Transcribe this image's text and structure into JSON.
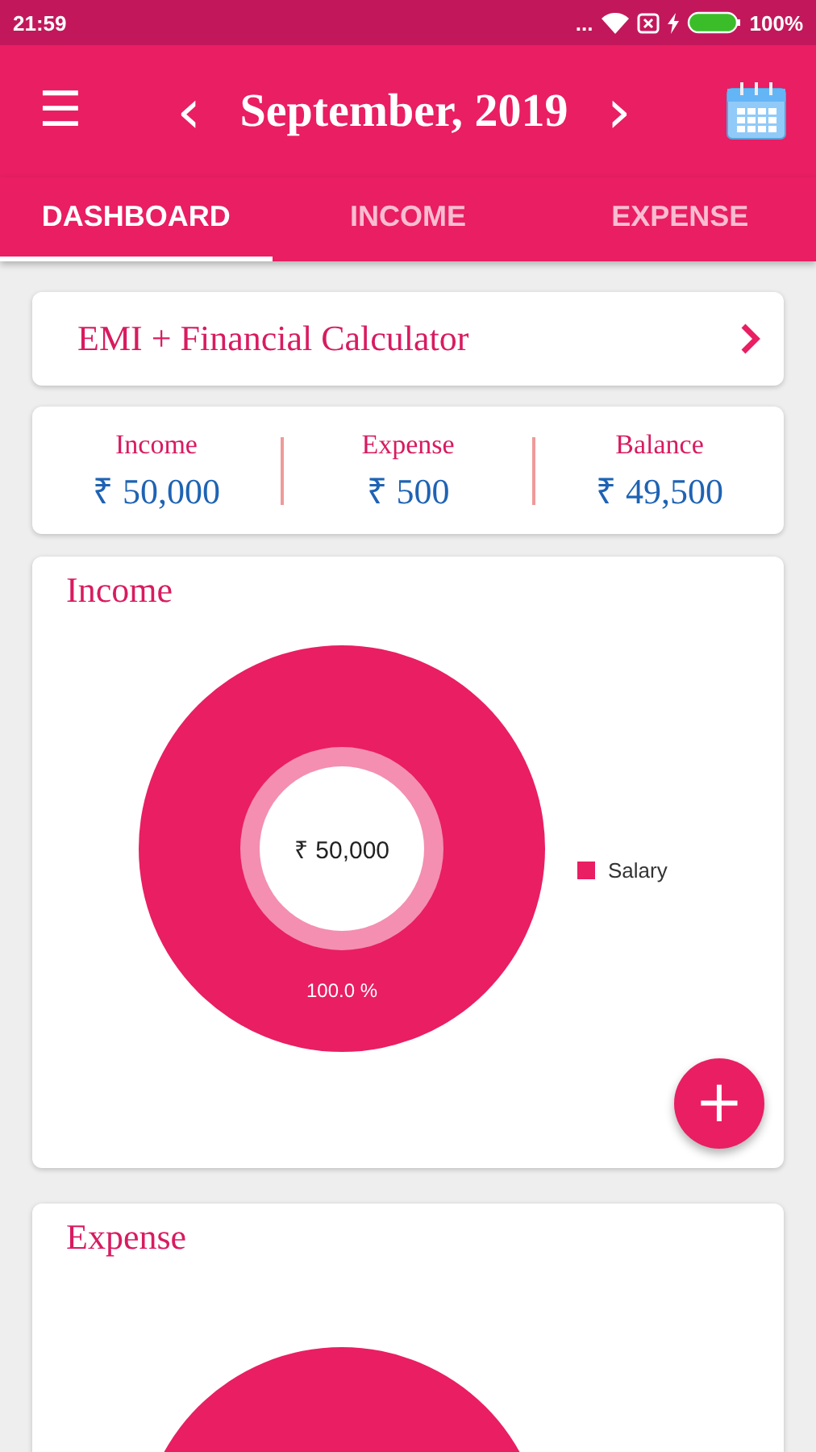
{
  "status_bar": {
    "time": "21:59",
    "dots": "...",
    "battery_text": "100%"
  },
  "app_bar": {
    "menu": "☰",
    "prev": "‹",
    "title": "September, 2019",
    "next": "›"
  },
  "tabs": [
    {
      "label": "DASHBOARD",
      "selected": true
    },
    {
      "label": "INCOME",
      "selected": false
    },
    {
      "label": "EXPENSE",
      "selected": false
    }
  ],
  "calculator": {
    "label": "EMI + Financial Calculator"
  },
  "summary": [
    {
      "label": "Income",
      "amount": "₹ 50,000"
    },
    {
      "label": "Expense",
      "amount": "₹ 500"
    },
    {
      "label": "Balance",
      "amount": "₹ 49,500"
    }
  ],
  "income_card": {
    "title": "Income",
    "center_label": "₹ 50,000",
    "fab": "+",
    "chart_data": {
      "type": "donut",
      "categories": [
        "Salary"
      ],
      "series": [
        {
          "color": "#e91e63",
          "values": [
            100
          ]
        }
      ],
      "value_labels": [
        "100.0 %"
      ]
    }
  },
  "expense_card": {
    "title": "Expense"
  }
}
